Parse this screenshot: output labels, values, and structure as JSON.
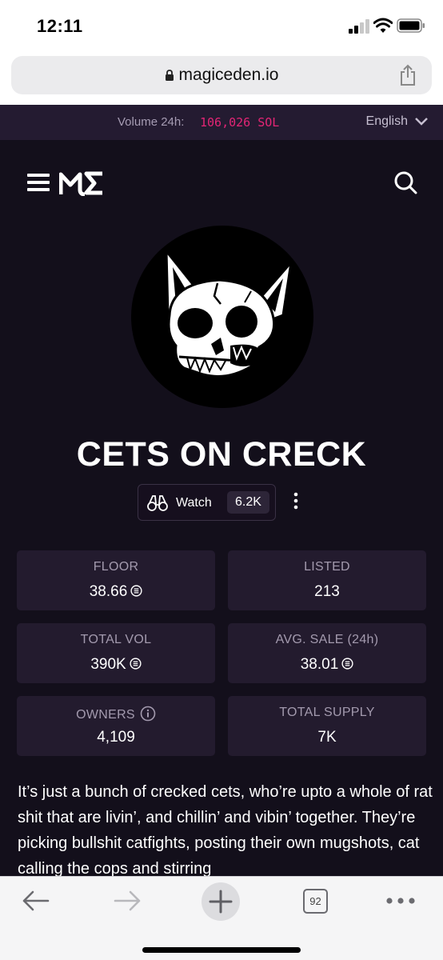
{
  "status_bar": {
    "time": "12:11"
  },
  "browser": {
    "url": "magiceden.io",
    "tab_count": "92"
  },
  "ticker": {
    "volume_label": "Volume 24h:",
    "volume_value": "106,026 SOL",
    "language": "English"
  },
  "collection": {
    "name": "CETS ON CRECK",
    "watch_label": "Watch",
    "watch_count": "6.2K",
    "stats": {
      "floor_label": "FLOOR",
      "floor_value": "38.66",
      "listed_label": "LISTED",
      "listed_value": "213",
      "total_vol_label": "TOTAL VOL",
      "total_vol_value": "390K",
      "avg_sale_label": "AVG. SALE (24h)",
      "avg_sale_value": "38.01",
      "owners_label": "OWNERS",
      "owners_value": "4,109",
      "supply_label": "TOTAL SUPPLY",
      "supply_value": "7K"
    },
    "description": "It’s just a bunch of crecked cets, who’re upto a whole of rat shit that are livin’, and chillin’ and vibin’ together. They’re picking bullshit catfights, posting their own mugshots, cat calling the cops and stirring"
  },
  "colors": {
    "accent": "#e42575",
    "page_bg": "#130f1b",
    "card_bg": "#231b2e"
  },
  "icons": [
    "lock-icon",
    "share-icon",
    "chevron-down-icon",
    "hamburger-icon",
    "magic-eden-logo",
    "search-icon",
    "binoculars-icon",
    "kebab-menu-icon",
    "solana-icon",
    "info-icon",
    "back-arrow-icon",
    "forward-arrow-icon",
    "plus-icon",
    "tabs-icon",
    "more-dots-icon"
  ]
}
